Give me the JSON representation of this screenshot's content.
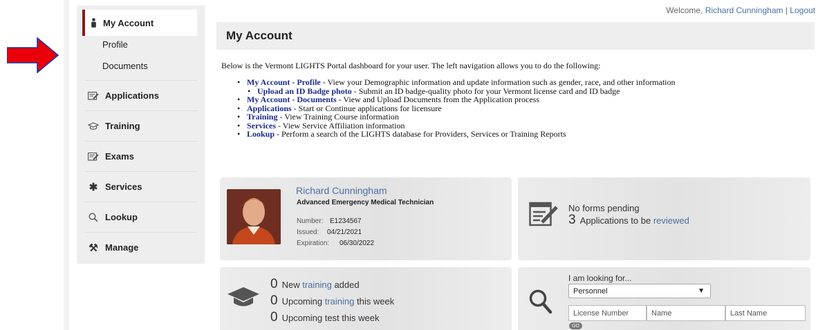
{
  "header": {
    "welcome_prefix": "Welcome, ",
    "user_name": "Richard Cunningham",
    "separator": " | ",
    "logout": "Logout"
  },
  "sidebar": {
    "active": {
      "label": "My Account",
      "icon": "person-icon"
    },
    "subitems": [
      {
        "label": "Profile"
      },
      {
        "label": "Documents"
      }
    ],
    "items": [
      {
        "label": "Applications",
        "icon": "form-edit-icon"
      },
      {
        "label": "Training",
        "icon": "training-icon"
      },
      {
        "label": "Exams",
        "icon": "form-edit-icon"
      },
      {
        "label": "Services",
        "icon": "asterisk-icon"
      },
      {
        "label": "Lookup",
        "icon": "search-icon"
      },
      {
        "label": "Manage",
        "icon": "tools-icon"
      }
    ]
  },
  "main": {
    "title": "My Account",
    "intro": "Below is the Vermont LIGHTS Portal dashboard for your user. The left navigation allows you to do the following:",
    "bullets": [
      {
        "term": "My Account - Profile",
        "desc": " - View your Demographic information and update information such as gender, race, and other information"
      },
      {
        "term": "Upload an ID Badge photo",
        "desc": " - Submit an ID badge-quality photo for your Vermont license card and ID badge"
      },
      {
        "term": "My Account - Documents",
        "desc": " - View and Upload Documents from the Application process"
      },
      {
        "term": "Applications",
        "desc": " - Start or Continue applications for licensure"
      },
      {
        "term": "Training",
        "desc": " - View Training Course information"
      },
      {
        "term": "Services",
        "desc": " - View Service Affiliation information"
      },
      {
        "term": "Lookup",
        "desc": " - Perform a search of the LIGHTS database for Providers, Services or Training Reports"
      }
    ]
  },
  "profile_card": {
    "name": "Richard Cunningham",
    "title": "Advanced Emergency Medical Technician",
    "number_label": "Number:",
    "number": "E1234567",
    "issued_label": "Issued:",
    "issued": "04/21/2021",
    "expiration_label": "Expiration:",
    "expiration": "06/30/2022"
  },
  "forms_card": {
    "pending": "No forms pending",
    "count": "3",
    "text": "Applications to be ",
    "link": "reviewed"
  },
  "training_card": {
    "rows": [
      {
        "count": "0",
        "pre": "New ",
        "link": "training",
        "post": " added"
      },
      {
        "count": "0",
        "pre": "Upcoming ",
        "link": "training",
        "post": " this week"
      },
      {
        "count": "0",
        "pre": "Upcoming test this week",
        "link": "",
        "post": ""
      }
    ]
  },
  "lookup_card": {
    "label": "I am looking for...",
    "selected": "Personnel",
    "placeholders": {
      "license": "License Number",
      "name": "Name",
      "last_name": "Last Name"
    },
    "go": "GO"
  },
  "colors": {
    "accent": "#8b1a1a",
    "link": "#4a6fa5",
    "bullet_term": "#1b2a8a",
    "annotation_arrow": "#e8000b"
  }
}
